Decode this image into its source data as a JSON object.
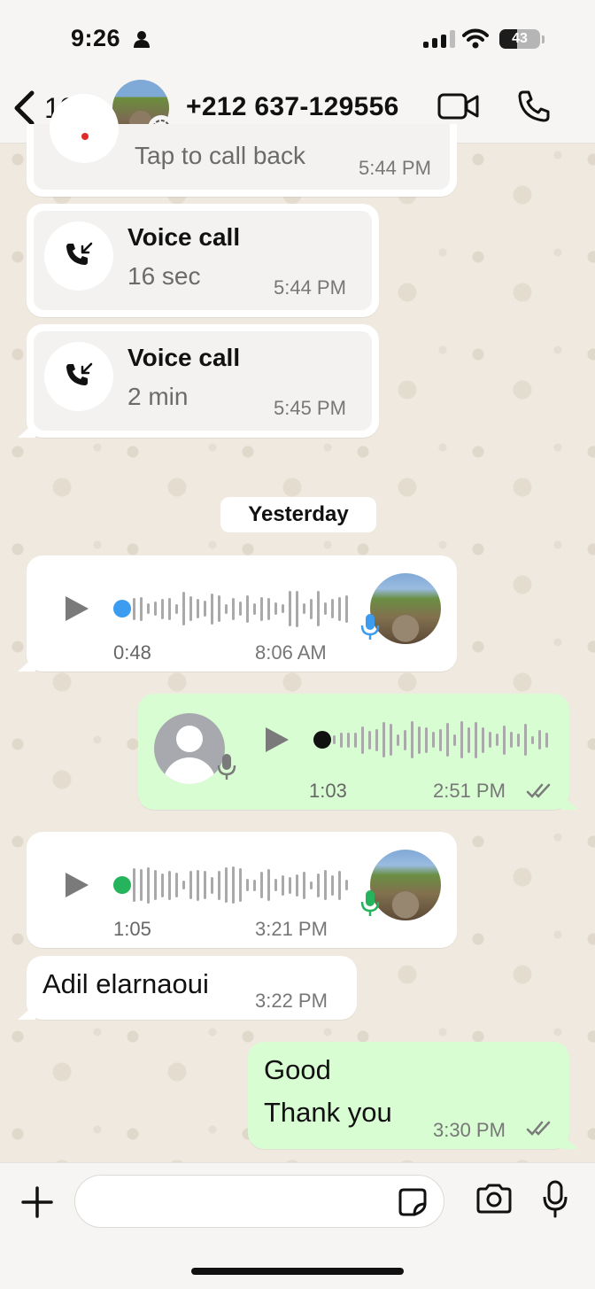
{
  "status_bar": {
    "time": "9:26",
    "battery": "43",
    "battery_level_percent": 43
  },
  "header": {
    "back_count": "13",
    "contact": "+212 637-129556"
  },
  "colors": {
    "incoming_bubble": "#ffffff",
    "outgoing_bubble": "#d9fdd3",
    "read_ticks": "#7a7a7a",
    "mic_blue": "#3b9cf0",
    "mic_green": "#25b35b",
    "dot_blue": "#3b9cf0",
    "dot_green": "#25b35b"
  },
  "messages": {
    "missed_call": {
      "subtitle": "Tap to call back",
      "time": "5:44 PM"
    },
    "call_1": {
      "title": "Voice call",
      "duration": "16 sec",
      "time": "5:44 PM",
      "icon": "incoming-call-icon"
    },
    "call_2": {
      "title": "Voice call",
      "duration": "2 min",
      "time": "5:45 PM",
      "icon": "incoming-call-icon"
    },
    "date_separator": "Yesterday",
    "voice_1": {
      "duration": "0:48",
      "time": "8:06 AM",
      "direction": "incoming"
    },
    "voice_2": {
      "duration": "1:03",
      "time": "2:51 PM",
      "direction": "outgoing",
      "status": "read"
    },
    "voice_3": {
      "duration": "1:05",
      "time": "3:21 PM",
      "direction": "incoming"
    },
    "text_1": {
      "text": "Adil elarnaoui",
      "time": "3:22 PM",
      "direction": "incoming"
    },
    "text_2": {
      "line1": "Good",
      "line2": "Thank you",
      "time": "3:30 PM",
      "direction": "outgoing",
      "status": "read"
    }
  },
  "input_bar": {
    "placeholder": "",
    "icons": [
      "plus-icon",
      "sticker-icon",
      "camera-icon",
      "mic-icon"
    ]
  }
}
